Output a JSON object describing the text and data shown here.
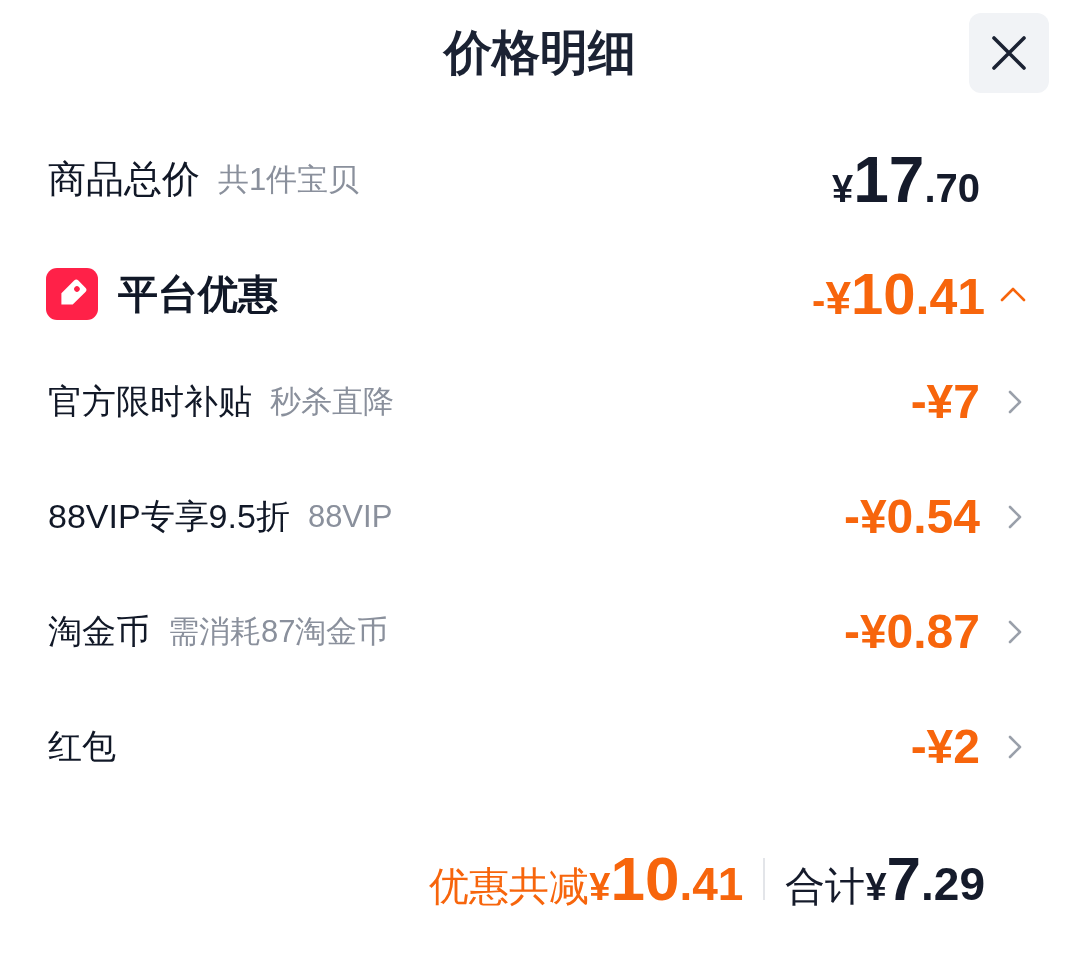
{
  "header": {
    "title": "价格明细"
  },
  "total": {
    "label": "商品总价",
    "note": "共1件宝贝",
    "price": {
      "currency": "¥",
      "whole": "17",
      "fraction": ".70"
    }
  },
  "discount": {
    "label": "平台优惠",
    "expanded": true,
    "amount": {
      "sign": "-",
      "currency": "¥",
      "whole": "10",
      "fraction": ".41"
    },
    "items": [
      {
        "label": "官方限时补贴",
        "note": "秒杀直降",
        "amount": "-¥7"
      },
      {
        "label": "88VIP专享9.5折",
        "note": "88VIP",
        "amount": "-¥0.54"
      },
      {
        "label": "淘金币",
        "note": "需消耗87淘金币",
        "amount": "-¥0.87"
      },
      {
        "label": "红包",
        "amount": "-¥2"
      }
    ]
  },
  "footer": {
    "savings_label": "优惠共减",
    "savings": {
      "currency": "¥",
      "whole": "10",
      "fraction": ".41"
    },
    "total_label": "合计",
    "total": {
      "currency": "¥",
      "whole": "7",
      "fraction": ".29"
    }
  }
}
